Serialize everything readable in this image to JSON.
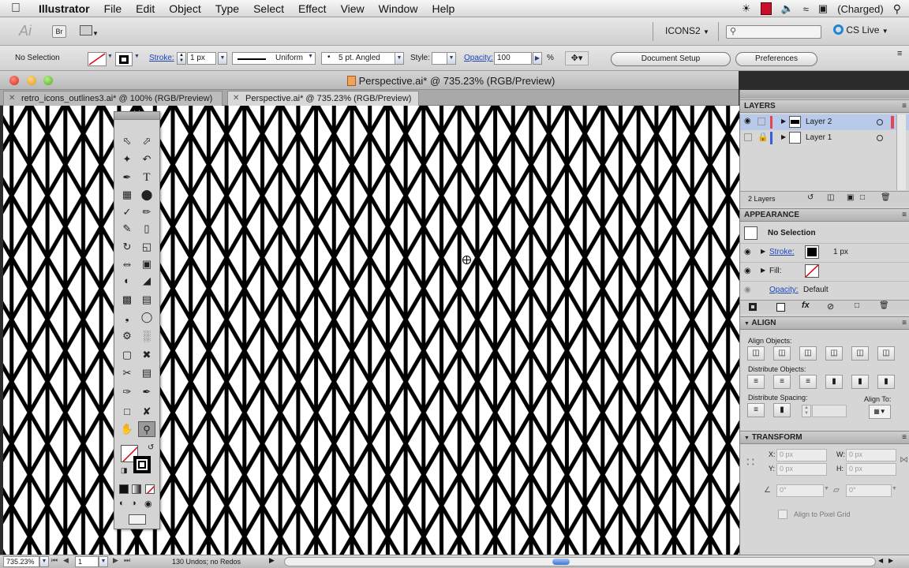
{
  "menubar": {
    "apple_icon": "apple-icon",
    "items": [
      "Illustrator",
      "File",
      "Edit",
      "Object",
      "Type",
      "Select",
      "Effect",
      "View",
      "Window",
      "Help"
    ],
    "battery": "(Charged)"
  },
  "appbar": {
    "ai_logo": "Ai",
    "bridge": "Br",
    "workspace": "ICONS2",
    "cs_live": "CS Live"
  },
  "control": {
    "selection": "No Selection",
    "stroke_label": "Stroke:",
    "stroke_value": "1 px",
    "profile": "Uniform",
    "brush": "5 pt. Angled",
    "style_label": "Style:",
    "opacity_label": "Opacity:",
    "opacity_value": "100",
    "opacity_unit": "%",
    "document_setup": "Document Setup",
    "preferences": "Preferences"
  },
  "window": {
    "title": "Perspective.ai* @ 735.23% (RGB/Preview)",
    "tabs": [
      {
        "label": "retro_icons_outlines3.ai* @ 100% (RGB/Preview)",
        "active": false
      },
      {
        "label": "Perspective.ai* @ 735.23% (RGB/Preview)",
        "active": true
      }
    ]
  },
  "status": {
    "zoom": "735.23%",
    "artboard": "1",
    "info": "130 Undos; no Redos"
  },
  "layers": {
    "title": "LAYERS",
    "items": [
      {
        "name": "Layer 2",
        "color": "#e8434f",
        "selected": true
      },
      {
        "name": "Layer 1",
        "color": "#3b5bd8",
        "selected": false
      }
    ],
    "count": "2 Layers"
  },
  "appearance": {
    "title": "APPEARANCE",
    "selection": "No Selection",
    "stroke_label": "Stroke:",
    "stroke_value": "1 px",
    "fill_label": "Fill:",
    "opacity_label": "Opacity:",
    "opacity_value": "Default"
  },
  "align": {
    "title": "ALIGN",
    "objects_label": "Align Objects:",
    "distribute_label": "Distribute Objects:",
    "spacing_label": "Distribute Spacing:",
    "align_to_label": "Align To:"
  },
  "transform": {
    "title": "TRANSFORM",
    "x_label": "X:",
    "x_value": "0 px",
    "y_label": "Y:",
    "y_value": "0 px",
    "w_label": "W:",
    "w_value": "0 px",
    "h_label": "H:",
    "h_value": "0 px",
    "rotate_value": "0°",
    "shear_value": "0°",
    "pixel_grid": "Align to Pixel Grid"
  }
}
